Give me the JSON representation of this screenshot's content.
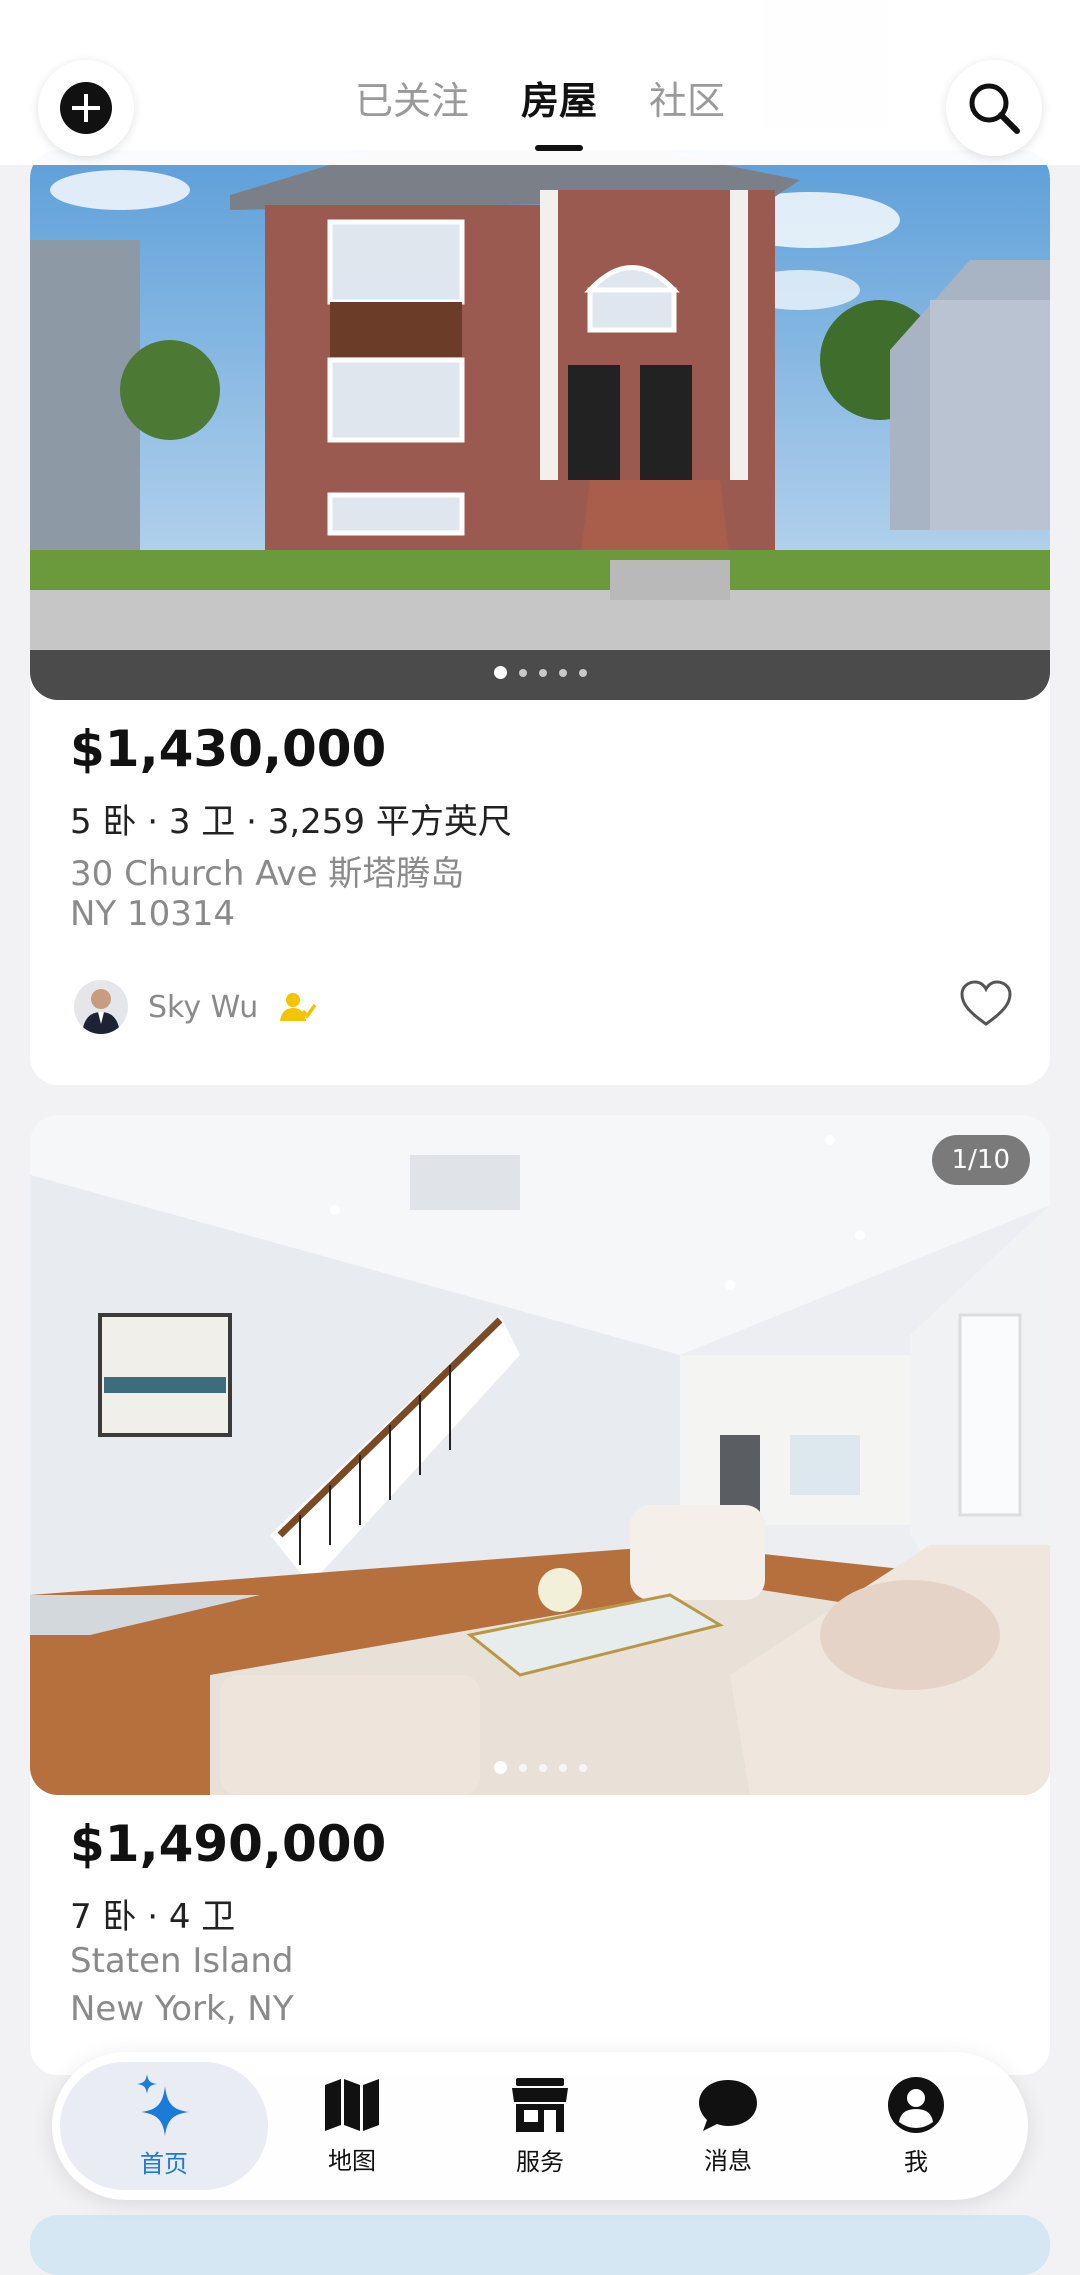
{
  "header": {
    "tabs": [
      {
        "label": "已关注",
        "active": false
      },
      {
        "label": "房屋",
        "active": true
      },
      {
        "label": "社区",
        "active": false
      }
    ],
    "icons": {
      "add": "plus-circle-icon",
      "search": "search-icon"
    }
  },
  "listings": [
    {
      "price": "$1,430,000",
      "specs": "5 卧 · 3 卫 · 3,259 平方英尺",
      "address_line1": "30 Church Ave 斯塔腾岛",
      "address_line2": "NY  10314",
      "agent_name": "Sky Wu",
      "photo_dots": 5,
      "active_dot": 0
    },
    {
      "price": "$1,490,000",
      "specs": "7 卧 · 4 卫",
      "address_line1": "Staten Island",
      "address_line2": "New York, NY",
      "photo_counter": "1/10",
      "photo_dots": 5,
      "active_dot": 0
    }
  ],
  "bottom_nav": {
    "items": [
      {
        "label": "首页",
        "icon": "sparkle-icon",
        "active": true
      },
      {
        "label": "地图",
        "icon": "map-icon",
        "active": false
      },
      {
        "label": "服务",
        "icon": "store-icon",
        "active": false
      },
      {
        "label": "消息",
        "icon": "chat-bubble-icon",
        "active": false
      },
      {
        "label": "我",
        "icon": "profile-icon",
        "active": false
      }
    ],
    "active_color": "#1a7bd9"
  }
}
